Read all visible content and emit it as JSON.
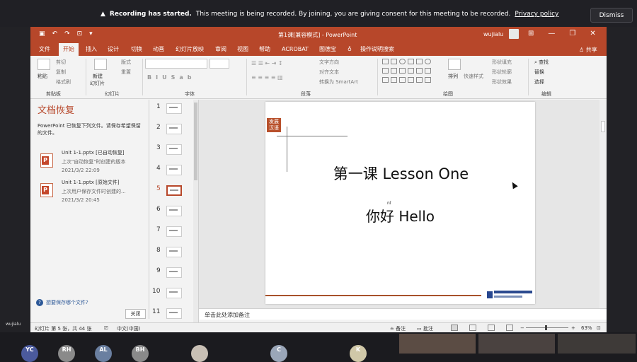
{
  "banner": {
    "bold": "Recording has started.",
    "text": "This meeting is being recorded. By joining, you are giving consent for this meeting to be recorded.",
    "link": "Privacy policy",
    "dismiss": "Dismiss"
  },
  "zoom": {
    "username": "wujialu",
    "participants": [
      "YC",
      "RH",
      "AL",
      "BH",
      "",
      "C",
      "K"
    ]
  },
  "titlebar": {
    "title": "第1课[兼容模式] - PowerPoint",
    "user": "wujialu"
  },
  "tabs": [
    "文件",
    "开始",
    "插入",
    "设计",
    "切换",
    "动画",
    "幻灯片放映",
    "审阅",
    "视图",
    "帮助",
    "ACROBAT",
    "图德宝",
    "操作说明搜索"
  ],
  "share": "共享",
  "ribbon": {
    "clipboard": {
      "paste": "粘贴",
      "cut": "剪切",
      "copy": "复制",
      "format_painter": "格式刷",
      "label": "剪贴板"
    },
    "slides": {
      "new_slide": "新建",
      "new_slide2": "幻灯片",
      "layout": "版式",
      "reset": "重置",
      "label": "幻灯片"
    },
    "font": {
      "label": "字体"
    },
    "paragraph": {
      "text_direction": "文字方向",
      "align_text": "对齐文本",
      "smartart": "转换为 SmartArt",
      "label": "段落"
    },
    "drawing": {
      "arrange": "排列",
      "quick_styles": "快速样式",
      "fill": "形状填充",
      "outline": "形状轮廓",
      "effects": "形状效果",
      "label": "绘图"
    },
    "editing": {
      "find": "查找",
      "replace": "替换",
      "select": "选择",
      "label": "编辑"
    }
  },
  "recovery": {
    "title": "文档恢复",
    "desc": "PowerPoint 已恢复下列文件。请保存希望保留的文件。",
    "files": [
      {
        "name": "Unit 1-1.pptx  [已自动恢复]",
        "sub": "上次\"自动恢复\"时创建的版本",
        "date": "2021/3/2 22:09"
      },
      {
        "name": "Unit 1-1.pptx  [原始文件]",
        "sub": "上次用户保存文件时创建的...",
        "date": "2021/3/2 20:45"
      }
    ],
    "help": "想要保存哪个文件?",
    "close": "关闭"
  },
  "thumbs": [
    "1",
    "2",
    "3",
    "4",
    "5",
    "6",
    "7",
    "8",
    "9",
    "10",
    "11"
  ],
  "slide": {
    "badge": "发展汉语",
    "title1": "第一课 Lesson One",
    "title2": "你好  Hello",
    "pinyin": "nǐ"
  },
  "notes": "单击此处添加备注",
  "status": {
    "slide_info": "幻灯片 第 5 张，共 44 张",
    "language": "中文(中国)",
    "notes": "备注",
    "comments": "批注",
    "zoom": "63%"
  }
}
